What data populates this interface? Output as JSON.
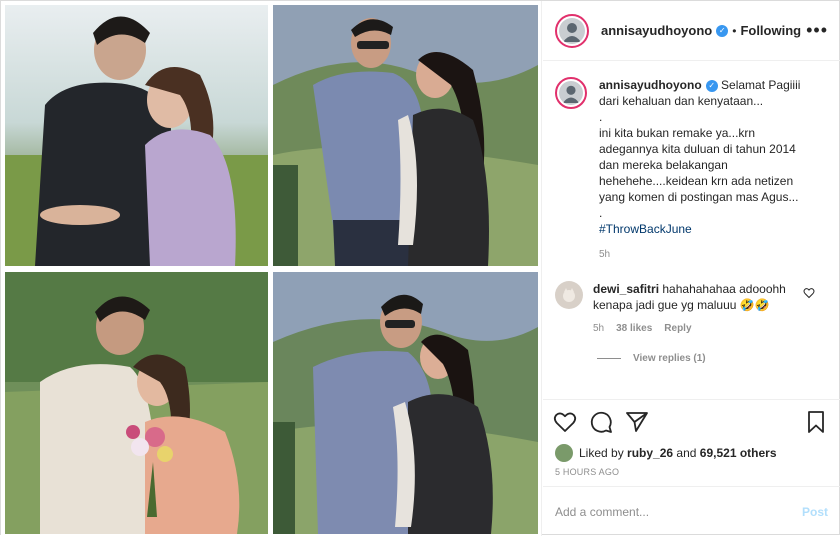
{
  "post": {
    "username": "annisayudhoyono",
    "follow_status": "Following",
    "more_label": "•••",
    "verified_glyph": "✓"
  },
  "photos": [
    {
      "name": "photo-couple-lake",
      "icon": "photo"
    },
    {
      "name": "photo-couple-mountain",
      "icon": "photo"
    },
    {
      "name": "photo-couple-flowers",
      "icon": "photo"
    },
    {
      "name": "photo-couple-forehead-kiss",
      "icon": "photo"
    }
  ],
  "caption": {
    "username": "annisayudhoyono",
    "lines": [
      "Selamat Pagiiii",
      "dari kehaluan dan kenyataan...",
      ".",
      "ini kita bukan remake ya...krn",
      "adegannya kita duluan di tahun 2014",
      "dan mereka belakangan",
      "hehehehe....keidean krn ada netizen",
      "yang komen di postingan mas Agus...",
      "."
    ],
    "hashtag": "#ThrowBackJune",
    "time": "5h"
  },
  "comment": {
    "username": "dewi_safitri",
    "text": "hahahahahaa adooohh kenapa jadi gue yg maluuu 🤣🤣",
    "time": "5h",
    "likes": "38 likes",
    "reply": "Reply",
    "view_replies": "View replies (1)"
  },
  "actions": {
    "like_icon": "heart-icon",
    "comment_icon": "comment-icon",
    "share_icon": "share-icon",
    "save_icon": "bookmark-icon"
  },
  "likes": {
    "prefix": "Liked by",
    "user": "ruby_26",
    "joiner": "and",
    "others": "69,521 others"
  },
  "timestamp": "5 HOURS AGO",
  "add_comment": {
    "placeholder": "Add a comment...",
    "post_label": "Post"
  },
  "colors": {
    "story_ring": "#e1306c",
    "verified": "#3897f0",
    "hashtag": "#00376b",
    "post_button": "#b2dffc"
  }
}
